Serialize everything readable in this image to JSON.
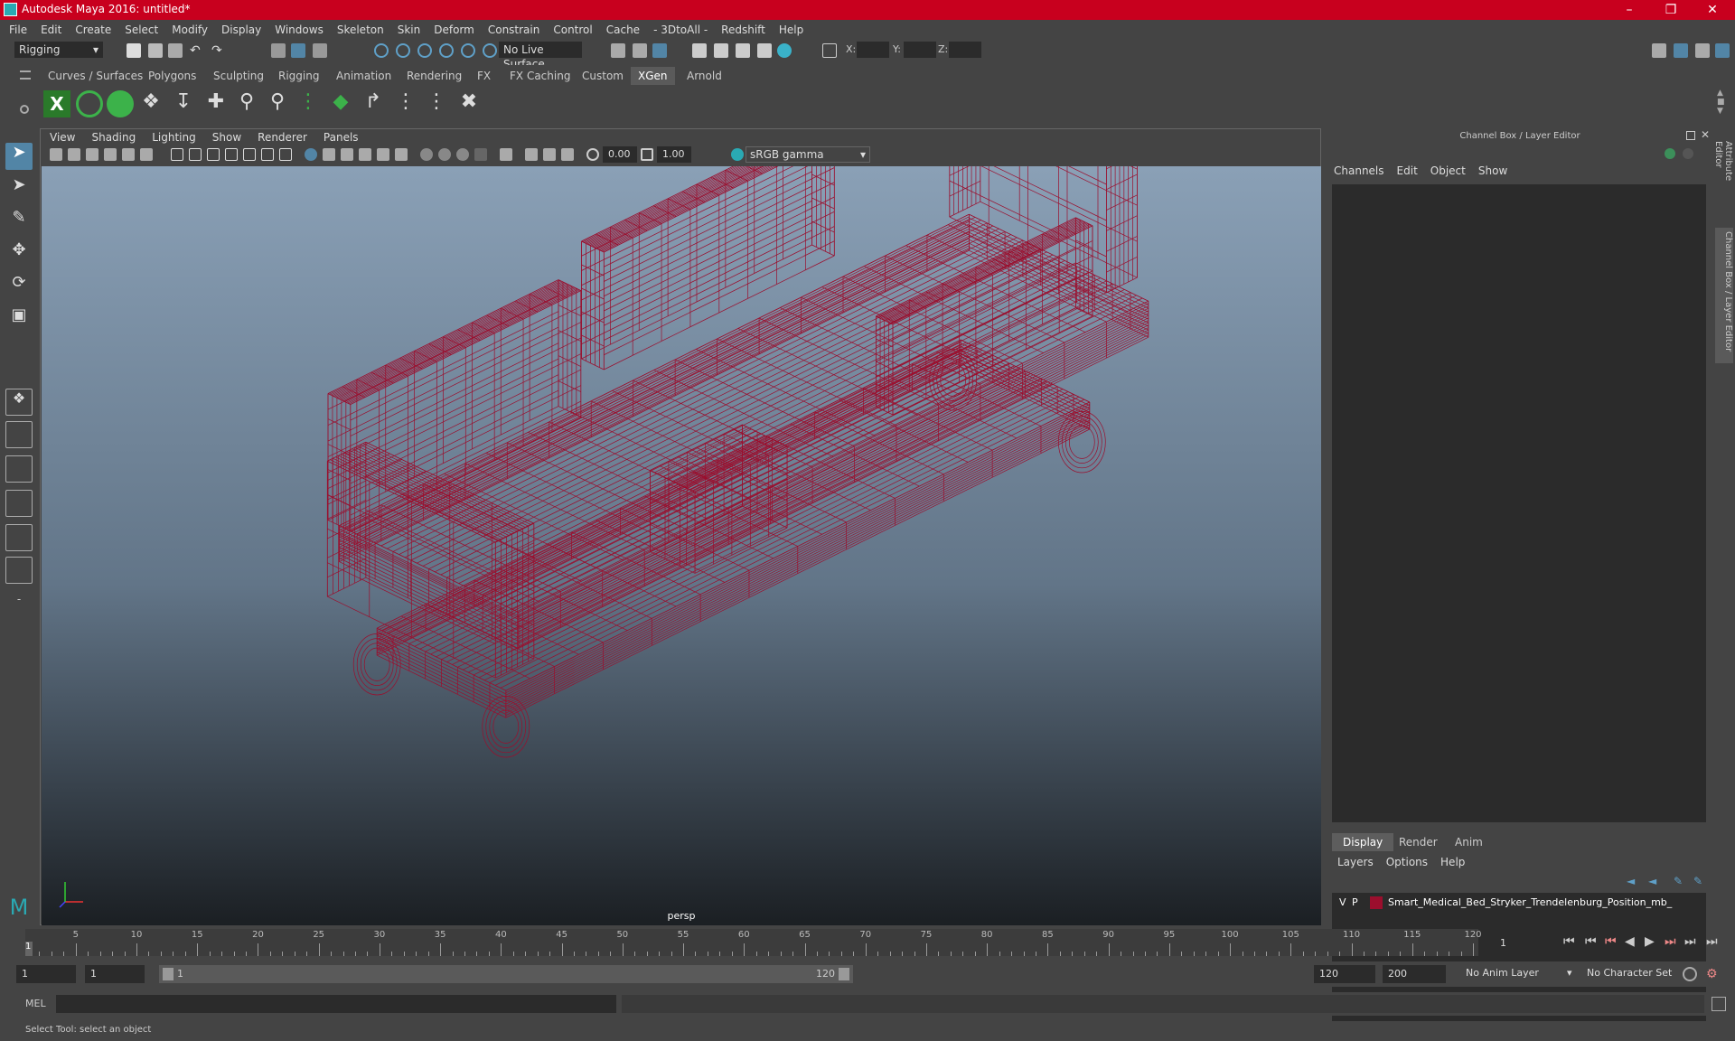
{
  "window": {
    "title": "Autodesk Maya 2016: untitled*"
  },
  "menubar": [
    "File",
    "Edit",
    "Create",
    "Select",
    "Modify",
    "Display",
    "Windows",
    "Skeleton",
    "Skin",
    "Deform",
    "Constrain",
    "Control",
    "Cache",
    "- 3DtoAll -",
    "Redshift",
    "Help"
  ],
  "statusline": {
    "menuset": "Rigging",
    "live_surface": "No Live Surface",
    "x_label": "X:",
    "y_label": "Y:",
    "z_label": "Z:"
  },
  "shelf_tabs": [
    "Curves / Surfaces",
    "Polygons",
    "Sculpting",
    "Rigging",
    "Animation",
    "Rendering",
    "FX",
    "FX Caching",
    "Custom",
    "XGen",
    "Arnold"
  ],
  "active_shelf_tab": "XGen",
  "viewport": {
    "menu": [
      "View",
      "Shading",
      "Lighting",
      "Show",
      "Renderer",
      "Panels"
    ],
    "exposure": "0.00",
    "gamma": "1.00",
    "color_space": "sRGB gamma",
    "camera": "persp"
  },
  "channel_box": {
    "title": "Channel Box / Layer Editor",
    "menu": [
      "Channels",
      "Edit",
      "Object",
      "Show"
    ],
    "layer_tabs": [
      "Display",
      "Render",
      "Anim"
    ],
    "layer_menu": [
      "Layers",
      "Options",
      "Help"
    ],
    "layer": {
      "v": "V",
      "p": "P",
      "name": "Smart_Medical_Bed_Stryker_Trendelenburg_Position_mb_",
      "color": "#9b0e2d"
    }
  },
  "right_tabs": [
    "Attribute Editor",
    "Channel Box / Layer Editor"
  ],
  "timeslider": {
    "ticks": [
      5,
      10,
      15,
      20,
      25,
      30,
      35,
      40,
      45,
      50,
      55,
      60,
      65,
      70,
      75,
      80,
      85,
      90,
      95,
      100,
      105,
      110,
      115,
      120
    ],
    "current_frame": "1",
    "frame_field": "1"
  },
  "range": {
    "start": "1",
    "inner_start": "1",
    "slider_start": "1",
    "slider_end": "120",
    "end": "120",
    "max": "200",
    "anim_layer": "No Anim Layer",
    "character_set": "No Character Set"
  },
  "cmdline": {
    "label": "MEL"
  },
  "helpline": {
    "text": "Select Tool: select an object"
  },
  "colors": {
    "wire": "#9b0e2d",
    "title_bar": "#c8001e",
    "accent": "#5285a6"
  }
}
